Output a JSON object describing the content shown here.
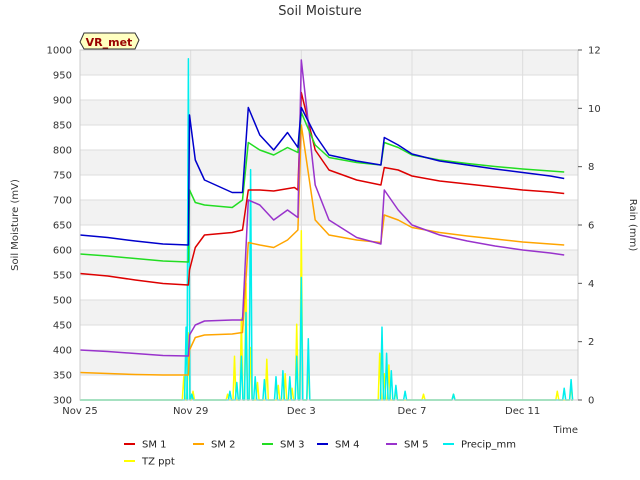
{
  "chart_data": {
    "type": "line",
    "title": "Soil Moisture",
    "site_label": "VR_met",
    "xlabel": "Time",
    "ylabel": "Soil Moisture (mV)",
    "y2label": "Rain (mm)",
    "xlim": [
      "2023-11-25",
      "2023-12-13"
    ],
    "ylim": [
      300,
      1000
    ],
    "y2lim": [
      0,
      12
    ],
    "x_ticks": [
      "2023-11-25",
      "2023-11-29",
      "2023-12-03",
      "2023-12-07",
      "2023-12-11"
    ],
    "x_tick_labels": [
      "Nov 25",
      "Nov 29",
      "Dec 3",
      "Dec 7",
      "Dec 11"
    ],
    "y_ticks": [
      300,
      350,
      400,
      450,
      500,
      550,
      600,
      650,
      700,
      750,
      800,
      850,
      900,
      950,
      1000
    ],
    "y2_ticks": [
      0,
      2,
      4,
      6,
      8,
      10,
      12
    ],
    "grid": true,
    "legend": "bottom",
    "series": [
      {
        "name": "SM 1",
        "axis": "left",
        "color": "#dd0000",
        "x": [
          "2023-11-25",
          "2023-11-26",
          "2023-11-27",
          "2023-11-28",
          "2023-11-28T22:00",
          "2023-11-28T23:00",
          "2023-11-29T04:00",
          "2023-11-29T12:00",
          "2023-11-30T12:00",
          "2023-11-30T21:00",
          "2023-12-01T02:00",
          "2023-12-01T12:00",
          "2023-12-02",
          "2023-12-02T18:00",
          "2023-12-02T21:00",
          "2023-12-03",
          "2023-12-03T12:00",
          "2023-12-04",
          "2023-12-05",
          "2023-12-05T21:00",
          "2023-12-06",
          "2023-12-06T12:00",
          "2023-12-07",
          "2023-12-08",
          "2023-12-09",
          "2023-12-10",
          "2023-12-11",
          "2023-12-12",
          "2023-12-12T12:00"
        ],
        "y": [
          553,
          548,
          540,
          533,
          530,
          560,
          605,
          630,
          635,
          640,
          720,
          720,
          718,
          725,
          720,
          915,
          800,
          760,
          740,
          730,
          765,
          760,
          748,
          738,
          732,
          726,
          720,
          716,
          713
        ]
      },
      {
        "name": "SM 2",
        "axis": "left",
        "color": "#ffa500",
        "x": [
          "2023-11-25",
          "2023-11-26",
          "2023-11-27",
          "2023-11-28",
          "2023-11-28T22:00",
          "2023-11-28T23:00",
          "2023-11-29T04:00",
          "2023-11-29T12:00",
          "2023-11-30T12:00",
          "2023-11-30T21:00",
          "2023-12-01T02:00",
          "2023-12-01T12:00",
          "2023-12-02",
          "2023-12-02T12:00",
          "2023-12-02T21:00",
          "2023-12-03",
          "2023-12-03T12:00",
          "2023-12-04",
          "2023-12-05",
          "2023-12-05T21:00",
          "2023-12-06",
          "2023-12-06T12:00",
          "2023-12-07",
          "2023-12-08",
          "2023-12-09",
          "2023-12-10",
          "2023-12-11",
          "2023-12-12",
          "2023-12-12T12:00"
        ],
        "y": [
          355,
          353,
          351,
          350,
          350,
          400,
          425,
          430,
          432,
          435,
          615,
          610,
          605,
          620,
          640,
          850,
          660,
          630,
          620,
          615,
          670,
          660,
          645,
          635,
          628,
          622,
          616,
          612,
          610
        ]
      },
      {
        "name": "SM 3",
        "axis": "left",
        "color": "#22dd22",
        "x": [
          "2023-11-25",
          "2023-11-26",
          "2023-11-27",
          "2023-11-28",
          "2023-11-28T22:00",
          "2023-11-28T23:00",
          "2023-11-29T04:00",
          "2023-11-29T12:00",
          "2023-11-30T12:00",
          "2023-11-30T21:00",
          "2023-12-01T02:00",
          "2023-12-01T12:00",
          "2023-12-02",
          "2023-12-02T12:00",
          "2023-12-02T21:00",
          "2023-12-03",
          "2023-12-03T12:00",
          "2023-12-04",
          "2023-12-05",
          "2023-12-05T21:00",
          "2023-12-06",
          "2023-12-06T12:00",
          "2023-12-07",
          "2023-12-08",
          "2023-12-09",
          "2023-12-10",
          "2023-12-11",
          "2023-12-12",
          "2023-12-12T12:00"
        ],
        "y": [
          592,
          588,
          583,
          578,
          576,
          720,
          695,
          690,
          685,
          700,
          815,
          800,
          790,
          805,
          795,
          875,
          810,
          785,
          775,
          770,
          815,
          805,
          790,
          780,
          773,
          767,
          762,
          758,
          756
        ]
      },
      {
        "name": "SM 4",
        "axis": "left",
        "color": "#0000cc",
        "x": [
          "2023-11-25",
          "2023-11-26",
          "2023-11-27",
          "2023-11-28",
          "2023-11-28T22:00",
          "2023-11-28T23:00",
          "2023-11-29T04:00",
          "2023-11-29T12:00",
          "2023-11-30T12:00",
          "2023-11-30T21:00",
          "2023-12-01T02:00",
          "2023-12-01T12:00",
          "2023-12-02",
          "2023-12-02T12:00",
          "2023-12-02T21:00",
          "2023-12-03",
          "2023-12-03T12:00",
          "2023-12-04",
          "2023-12-05",
          "2023-12-05T21:00",
          "2023-12-06",
          "2023-12-06T12:00",
          "2023-12-07",
          "2023-12-08",
          "2023-12-09",
          "2023-12-10",
          "2023-12-11",
          "2023-12-12",
          "2023-12-12T12:00"
        ],
        "y": [
          630,
          625,
          618,
          612,
          610,
          870,
          780,
          740,
          715,
          715,
          885,
          830,
          800,
          835,
          805,
          885,
          830,
          790,
          778,
          770,
          825,
          810,
          792,
          778,
          770,
          762,
          755,
          748,
          743
        ]
      },
      {
        "name": "SM 5",
        "axis": "left",
        "color": "#9933cc",
        "x": [
          "2023-11-25",
          "2023-11-26",
          "2023-11-27",
          "2023-11-28",
          "2023-11-28T22:00",
          "2023-11-28T23:00",
          "2023-11-29T04:00",
          "2023-11-29T12:00",
          "2023-11-30T12:00",
          "2023-11-30T21:00",
          "2023-12-01T02:00",
          "2023-12-01T12:00",
          "2023-12-02",
          "2023-12-02T12:00",
          "2023-12-02T21:00",
          "2023-12-03",
          "2023-12-03T12:00",
          "2023-12-04",
          "2023-12-05",
          "2023-12-05T21:00",
          "2023-12-06",
          "2023-12-06T12:00",
          "2023-12-07",
          "2023-12-08",
          "2023-12-09",
          "2023-12-10",
          "2023-12-11",
          "2023-12-12",
          "2023-12-12T12:00"
        ],
        "y": [
          400,
          397,
          393,
          389,
          388,
          430,
          450,
          458,
          460,
          460,
          700,
          690,
          660,
          680,
          665,
          980,
          730,
          660,
          625,
          612,
          720,
          680,
          650,
          630,
          618,
          608,
          600,
          594,
          590
        ]
      },
      {
        "name": "Precip_mm",
        "axis": "right",
        "color": "#00eeee",
        "x": [
          "2023-11-28T20:00",
          "2023-11-28T22:00",
          "2023-11-29T01:00",
          "2023-11-30T10:00",
          "2023-11-30T16:00",
          "2023-11-30T20:00",
          "2023-12-01T00:00",
          "2023-12-01T04:00",
          "2023-12-01T08:00",
          "2023-12-01T16:00",
          "2023-12-02T02:00",
          "2023-12-02T08:00",
          "2023-12-02T14:00",
          "2023-12-02T20:00",
          "2023-12-03T00:00",
          "2023-12-03T06:00",
          "2023-12-05T22:00",
          "2023-12-06T02:00",
          "2023-12-06T06:00",
          "2023-12-06T10:00",
          "2023-12-06T18:00",
          "2023-12-08T12:00",
          "2023-12-12T12:00",
          "2023-12-12T18:00"
        ],
        "y": [
          2.5,
          11.7,
          0.2,
          0.3,
          0.6,
          1.5,
          3.0,
          7.9,
          0.8,
          0.7,
          0.8,
          1.0,
          0.8,
          1.5,
          4.2,
          2.1,
          2.5,
          1.6,
          1.0,
          0.5,
          0.3,
          0.2,
          0.4,
          0.7
        ]
      },
      {
        "name": "TZ ppt",
        "axis": "right",
        "color": "#ffff00",
        "x": [
          "2023-11-28T18:00",
          "2023-11-28T22:00",
          "2023-11-29T02:00",
          "2023-11-30T08:00",
          "2023-11-30T14:00",
          "2023-11-30T20:00",
          "2023-12-01T00:00",
          "2023-12-01T04:00",
          "2023-12-01T10:00",
          "2023-12-01T18:00",
          "2023-12-02T04:00",
          "2023-12-02T10:00",
          "2023-12-02T16:00",
          "2023-12-02T20:00",
          "2023-12-03T00:00",
          "2023-12-03T06:00",
          "2023-12-05T20:00",
          "2023-12-06T00:00",
          "2023-12-06T04:00",
          "2023-12-06T10:00",
          "2023-12-07T10:00",
          "2023-12-08T12:00",
          "2023-12-12T06:00",
          "2023-12-12T18:00"
        ],
        "y": [
          0.8,
          2.3,
          0.3,
          0.2,
          1.5,
          2.8,
          4.0,
          1.8,
          0.6,
          1.4,
          0.5,
          0.9,
          0.4,
          2.6,
          5.8,
          1.2,
          1.6,
          0.9,
          1.2,
          0.3,
          0.2,
          0.2,
          0.3,
          0.5
        ]
      }
    ]
  }
}
